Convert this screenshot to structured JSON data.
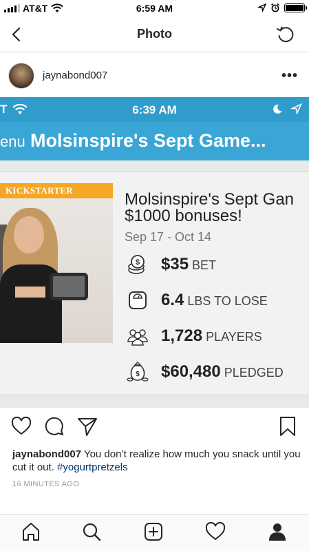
{
  "status_bar": {
    "carrier": "AT&T",
    "time": "6:59 AM"
  },
  "nav": {
    "title": "Photo"
  },
  "post": {
    "username": "jaynabond007",
    "more_label": "•••",
    "photo": {
      "inner_time": "6:39 AM",
      "inner_header_title": "Molsinspire's Sept Game...",
      "inner_menu_text": "enu",
      "card": {
        "banner": "KICKSTARTER",
        "title": "Molsinspire's Sept Gan",
        "subtitle": "$1000 bonuses!",
        "dates": "Sep 17 - Oct 14",
        "stats": [
          {
            "value": "$35",
            "label": "BET",
            "icon": "coins-icon"
          },
          {
            "value": "6.4",
            "label": "LBS TO LOSE",
            "icon": "scale-icon"
          },
          {
            "value": "1,728",
            "label": "PLAYERS",
            "icon": "players-icon"
          },
          {
            "value": "$60,480",
            "label": "PLEDGED",
            "icon": "money-bag-icon"
          }
        ]
      }
    },
    "caption": {
      "username": "jaynabond007",
      "text": " You don’t realize how much you snack until you cut it out. ",
      "hashtag": "#yogurtpretzels"
    },
    "timestamp": "16 MINUTES AGO"
  },
  "colors": {
    "inner_status_blue": "#2f9ccc",
    "inner_header_blue": "#39a6d6",
    "kickstarter_orange": "#f5a623",
    "hashtag_blue": "#003569"
  }
}
